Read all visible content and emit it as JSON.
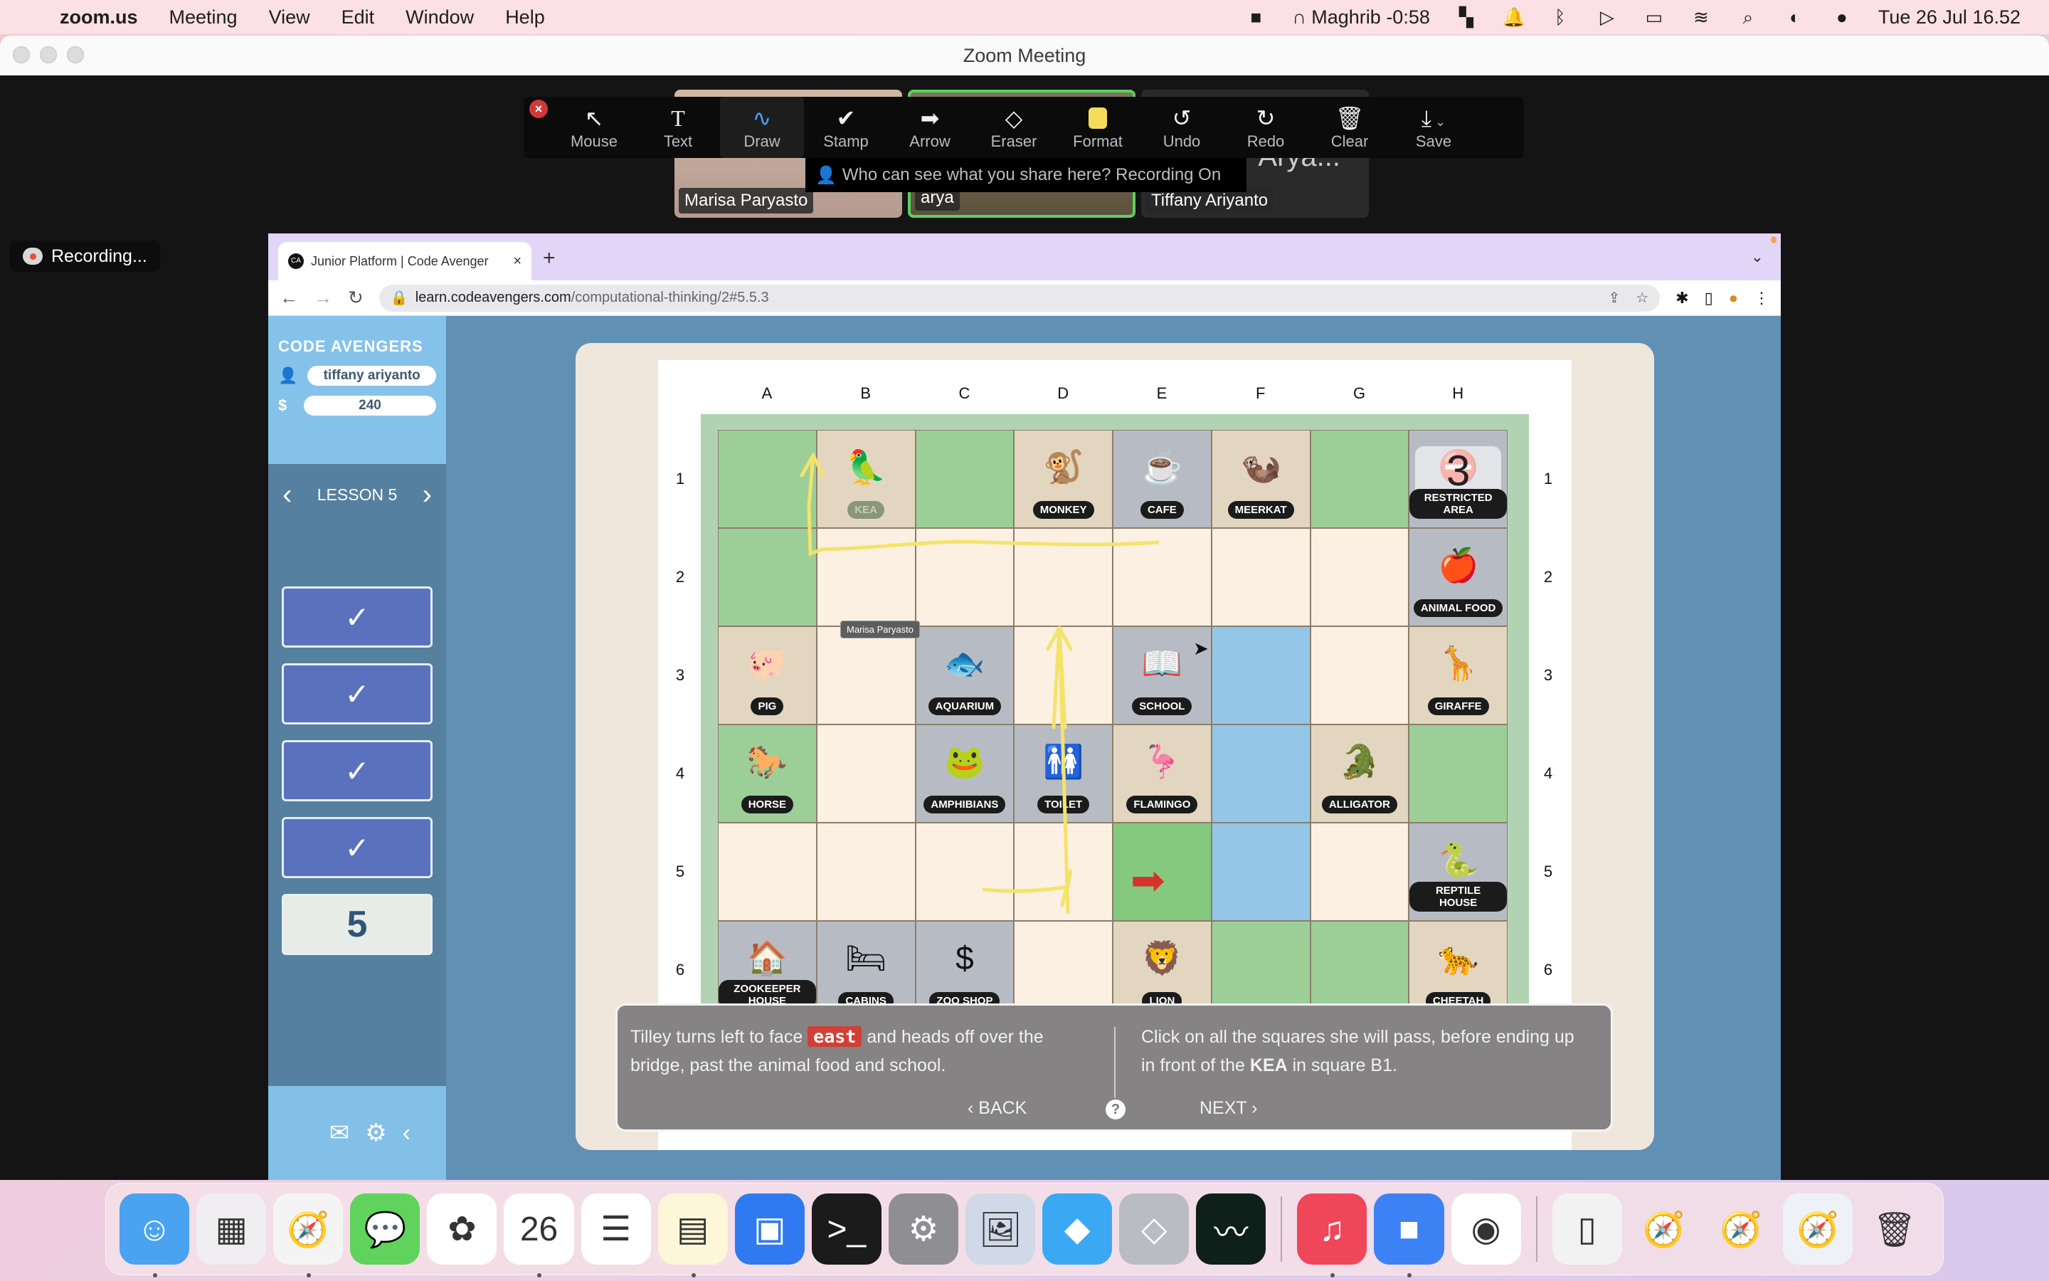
{
  "menubar": {
    "apple_icon": "apple-logo-icon",
    "app_name": "zoom.us",
    "menus": [
      "Meeting",
      "View",
      "Edit",
      "Window",
      "Help"
    ],
    "prayer_time": "Maghrib -0:58",
    "datetime": "Tue 26 Jul  16.52",
    "status_icons": [
      "zoom-icon",
      "mosque-icon",
      "window-manager-icon",
      "notification-bell-icon",
      "bluetooth-icon",
      "play-icon",
      "battery-icon",
      "wifi-icon",
      "spotlight-search-icon",
      "control-center-icon",
      "siri-icon"
    ]
  },
  "zoom_window": {
    "title": "Zoom Meeting",
    "participants": [
      {
        "name": "Marisa Paryasto",
        "active": false
      },
      {
        "name": "arya",
        "active": true
      },
      {
        "name": "Tiffany Ariyanto",
        "active": false
      }
    ],
    "overflow_name_fragment": "Arya...",
    "recording_label": "Recording...",
    "share_notice": "Who can see what you share here? Recording On",
    "toolbar": {
      "tools": [
        {
          "label": "Mouse",
          "icon": "↖",
          "active": false
        },
        {
          "label": "Text",
          "icon": "T",
          "active": false
        },
        {
          "label": "Draw",
          "icon": "∿",
          "active": true
        },
        {
          "label": "Stamp",
          "icon": "✔",
          "active": false
        },
        {
          "label": "Arrow",
          "icon": "➡",
          "active": false
        },
        {
          "label": "Eraser",
          "icon": "◇",
          "active": false
        },
        {
          "label": "Format",
          "icon": "",
          "active": false
        },
        {
          "label": "Undo",
          "icon": "↺",
          "active": false
        },
        {
          "label": "Redo",
          "icon": "↻",
          "active": false
        },
        {
          "label": "Clear",
          "icon": "🗑",
          "active": false
        },
        {
          "label": "Save",
          "icon": "⤓",
          "active": false
        }
      ],
      "format_color": "#f7dc5a",
      "close_label": "×"
    }
  },
  "browser": {
    "tab_title": "Junior Platform | Code Avenger",
    "favicon_text": "CA",
    "url_host": "learn.codeavengers.com",
    "url_path": "/computational-thinking/2#5.5.3"
  },
  "sidebar": {
    "brand": "CODE AVENGERS",
    "username": "tiffany ariyanto",
    "coins_symbol": "$",
    "coins": "240",
    "lesson_label": "LESSON 5",
    "lessons": [
      {
        "status": "complete",
        "mark": "✓"
      },
      {
        "status": "complete",
        "mark": "✓"
      },
      {
        "status": "complete",
        "mark": "✓"
      },
      {
        "status": "complete",
        "mark": "✓"
      },
      {
        "status": "current",
        "mark": "5"
      }
    ]
  },
  "map": {
    "columns": [
      "A",
      "B",
      "C",
      "D",
      "E",
      "F",
      "G",
      "H"
    ],
    "rows": [
      "1",
      "2",
      "3",
      "4",
      "5",
      "6"
    ],
    "cells": [
      [
        {
          "t": "tree",
          "l": ""
        },
        {
          "t": "enc",
          "l": "KEA",
          "i": "🦜",
          "kea": true
        },
        {
          "t": "tree",
          "l": ""
        },
        {
          "t": "enc",
          "l": "MONKEY",
          "i": "🐒"
        },
        {
          "t": "bldg",
          "l": "CAFE",
          "i": "☕"
        },
        {
          "t": "enc",
          "l": "MEERKAT",
          "i": "🦦"
        },
        {
          "t": "tree",
          "l": ""
        },
        {
          "t": "bldg",
          "l": "RESTRICTED AREA",
          "i": "⛔",
          "restricted": true
        }
      ],
      [
        {
          "t": "tree",
          "l": ""
        },
        {
          "t": "path",
          "l": ""
        },
        {
          "t": "path",
          "l": ""
        },
        {
          "t": "path",
          "l": ""
        },
        {
          "t": "path",
          "l": ""
        },
        {
          "t": "path",
          "l": ""
        },
        {
          "t": "path",
          "l": ""
        },
        {
          "t": "bldg",
          "l": "ANIMAL FOOD",
          "i": "🍎"
        }
      ],
      [
        {
          "t": "enc",
          "l": "PIG",
          "i": "🐖"
        },
        {
          "t": "path",
          "l": ""
        },
        {
          "t": "bldg",
          "l": "AQUARIUM",
          "i": "🐟"
        },
        {
          "t": "path",
          "l": ""
        },
        {
          "t": "bldg",
          "l": "SCHOOL",
          "i": "📖"
        },
        {
          "t": "water",
          "l": ""
        },
        {
          "t": "path",
          "l": ""
        },
        {
          "t": "enc",
          "l": "GIRAFFE",
          "i": "🦒"
        }
      ],
      [
        {
          "t": "tree",
          "l": "HORSE",
          "i": "🐎"
        },
        {
          "t": "path",
          "l": ""
        },
        {
          "t": "bldg",
          "l": "AMPHIBIANS",
          "i": "🐸"
        },
        {
          "t": "bldg",
          "l": "TOILET",
          "i": "🚻"
        },
        {
          "t": "enc",
          "l": "FLAMINGO",
          "i": "🦩"
        },
        {
          "t": "water",
          "l": ""
        },
        {
          "t": "enc",
          "l": "ALLIGATOR",
          "i": "🐊"
        },
        {
          "t": "tree",
          "l": ""
        }
      ],
      [
        {
          "t": "path",
          "l": ""
        },
        {
          "t": "path",
          "l": ""
        },
        {
          "t": "path",
          "l": ""
        },
        {
          "t": "path",
          "l": ""
        },
        {
          "t": "grass",
          "l": "",
          "start": true
        },
        {
          "t": "water",
          "l": ""
        },
        {
          "t": "path",
          "l": ""
        },
        {
          "t": "bldg",
          "l": "REPTILE HOUSE",
          "i": "🐍"
        }
      ],
      [
        {
          "t": "bldg",
          "l": "ZOOKEEPER HOUSE",
          "i": "🏠"
        },
        {
          "t": "bldg",
          "l": "CABINS",
          "i": "🛏"
        },
        {
          "t": "bldg",
          "l": "ZOO SHOP",
          "i": "$"
        },
        {
          "t": "path",
          "l": ""
        },
        {
          "t": "enc",
          "l": "LION",
          "i": "🦁"
        },
        {
          "t": "tree",
          "l": ""
        },
        {
          "t": "tree",
          "l": ""
        },
        {
          "t": "enc",
          "l": "CHEETAH",
          "i": "🐆"
        }
      ]
    ],
    "restricted_overlay_text": "3",
    "annotation_author": "Marisa Paryasto",
    "annotation_color": "#f4e36a",
    "start_arrow_color": "#d6332b"
  },
  "instructions": {
    "left_pre": "Tilley turns left to face ",
    "left_highlight": "east",
    "left_post": " and heads off over the bridge, past the animal food and school.",
    "right_pre": "Click on all the squares she will pass, before ending up in front of the ",
    "right_bold": "KEA",
    "right_post": " in square B1.",
    "back_label": "BACK",
    "next_label": "NEXT",
    "help_label": "?"
  },
  "dock": {
    "apps": [
      {
        "name": "Finder",
        "icon": "finder-icon",
        "glyph": "☺",
        "bg": "#4aa3f0",
        "running": true
      },
      {
        "name": "Launchpad",
        "icon": "launchpad-icon",
        "glyph": "▦",
        "bg": "#f0eef0",
        "running": false
      },
      {
        "name": "Safari",
        "icon": "safari-icon",
        "glyph": "🧭",
        "bg": "#f4f4f4",
        "running": true
      },
      {
        "name": "Messages",
        "icon": "messages-icon",
        "glyph": "💬",
        "bg": "#5fd35b",
        "running": false
      },
      {
        "name": "Photos",
        "icon": "photos-icon",
        "glyph": "✿",
        "bg": "#ffffff",
        "running": false
      },
      {
        "name": "Calendar",
        "icon": "calendar-icon",
        "glyph": "26",
        "bg": "#ffffff",
        "running": true
      },
      {
        "name": "Reminders",
        "icon": "reminders-icon",
        "glyph": "☰",
        "bg": "#ffffff",
        "running": false
      },
      {
        "name": "Notes",
        "icon": "notes-icon",
        "glyph": "▤",
        "bg": "#fdf6d8",
        "running": true
      },
      {
        "name": "Keynote",
        "icon": "keynote-icon",
        "glyph": "▣",
        "bg": "#2f7af0",
        "running": false
      },
      {
        "name": "Terminal",
        "icon": "terminal-icon",
        "glyph": ">_",
        "bg": "#1b1b1b",
        "running": false
      },
      {
        "name": "System Preferences",
        "icon": "system-preferences-icon",
        "glyph": "⚙",
        "bg": "#8e8e93",
        "running": false
      },
      {
        "name": "Preview",
        "icon": "preview-icon",
        "glyph": "🖼",
        "bg": "#cfd9e8",
        "running": false
      },
      {
        "name": "Windows App",
        "icon": "windows-app-icon",
        "glyph": "◆",
        "bg": "#3ba8f3",
        "running": false
      },
      {
        "name": "Roblox",
        "icon": "roblox-icon",
        "glyph": "◇",
        "bg": "#b9bcc2",
        "running": false
      },
      {
        "name": "Activity Monitor",
        "icon": "activity-monitor-icon",
        "glyph": "〰",
        "bg": "#0f1f1a",
        "running": false
      }
    ],
    "apps2": [
      {
        "name": "Music",
        "icon": "music-icon",
        "glyph": "♫",
        "bg": "#f0465a",
        "running": true
      },
      {
        "name": "Zoom",
        "icon": "zoom-icon",
        "glyph": "■",
        "bg": "#3d82f5",
        "running": true
      },
      {
        "name": "Chrome",
        "icon": "chrome-icon",
        "glyph": "◉",
        "bg": "#ffffff",
        "running": false
      }
    ],
    "others": [
      {
        "name": "Documents Stack",
        "icon": "documents-stack-icon",
        "glyph": "▯",
        "bg": "#f2f2f2"
      },
      {
        "name": "Safari Window 1",
        "icon": "safari-window-icon",
        "glyph": "🧭",
        "bg": "transparent"
      },
      {
        "name": "Safari Window 2",
        "icon": "safari-window-icon",
        "glyph": "🧭",
        "bg": "transparent"
      },
      {
        "name": "Safari Window 3",
        "icon": "safari-window-icon",
        "glyph": "🧭",
        "bg": "#eef2f8"
      },
      {
        "name": "Trash",
        "icon": "trash-icon",
        "glyph": "🗑",
        "bg": "transparent"
      }
    ]
  }
}
